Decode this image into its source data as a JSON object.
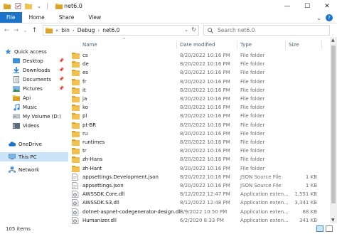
{
  "window": {
    "title": "net6.0",
    "controls": {
      "minimize": "—",
      "maximize": "☐",
      "close": "✕"
    }
  },
  "ribbon": {
    "tabs": [
      "File",
      "Home",
      "Share",
      "View"
    ],
    "expand_glyph": "⌄",
    "help_glyph": "?"
  },
  "address": {
    "back": "←",
    "forward": "→",
    "recent": "⌄",
    "up": "↑",
    "overflow": "«",
    "crumbs": [
      "bin",
      "Debug",
      "net6.0"
    ],
    "separator": "›",
    "dropdown": "⌄",
    "refresh": "↻"
  },
  "search": {
    "placeholder": "Search net6.0",
    "icon": "search-icon"
  },
  "nav": {
    "items": [
      {
        "label": "Quick access",
        "icon": "star-icon",
        "pinned": false
      },
      {
        "label": "Desktop",
        "icon": "desktop-icon",
        "pinned": true
      },
      {
        "label": "Downloads",
        "icon": "download-icon",
        "pinned": true
      },
      {
        "label": "Documents",
        "icon": "documents-icon",
        "pinned": true
      },
      {
        "label": "Pictures",
        "icon": "pictures-icon",
        "pinned": true
      },
      {
        "label": "Api",
        "icon": "folder-icon",
        "pinned": false
      },
      {
        "label": "Music",
        "icon": "music-icon",
        "pinned": false
      },
      {
        "label": "My Volume (D:)",
        "icon": "drive-icon",
        "pinned": false
      },
      {
        "label": "Videos",
        "icon": "videos-icon",
        "pinned": false
      },
      {
        "label": "OneDrive",
        "icon": "cloud-icon",
        "pinned": false
      },
      {
        "label": "This PC",
        "icon": "computer-icon",
        "pinned": false,
        "selected": true
      },
      {
        "label": "Network",
        "icon": "network-icon",
        "pinned": false
      }
    ],
    "pin_glyph": "📌"
  },
  "columns": {
    "name": "Name",
    "date": "Date modified",
    "type": "Type",
    "size": "Size",
    "sort_caret": "^"
  },
  "files": [
    {
      "name": "cs",
      "date": "8/20/2022 10:16 PM",
      "type": "File folder",
      "size": "",
      "kind": "folder"
    },
    {
      "name": "de",
      "date": "8/20/2022 10:16 PM",
      "type": "File folder",
      "size": "",
      "kind": "folder"
    },
    {
      "name": "es",
      "date": "8/20/2022 10:16 PM",
      "type": "File folder",
      "size": "",
      "kind": "folder"
    },
    {
      "name": "fr",
      "date": "8/20/2022 10:16 PM",
      "type": "File folder",
      "size": "",
      "kind": "folder"
    },
    {
      "name": "it",
      "date": "8/20/2022 10:16 PM",
      "type": "File folder",
      "size": "",
      "kind": "folder"
    },
    {
      "name": "ja",
      "date": "8/20/2022 10:16 PM",
      "type": "File folder",
      "size": "",
      "kind": "folder"
    },
    {
      "name": "ko",
      "date": "8/20/2022 10:16 PM",
      "type": "File folder",
      "size": "",
      "kind": "folder"
    },
    {
      "name": "pl",
      "date": "8/20/2022 10:16 PM",
      "type": "File folder",
      "size": "",
      "kind": "folder"
    },
    {
      "name": "pt-BR",
      "date": "8/20/2022 10:16 PM",
      "type": "File folder",
      "size": "",
      "kind": "folder"
    },
    {
      "name": "ru",
      "date": "8/20/2022 10:16 PM",
      "type": "File folder",
      "size": "",
      "kind": "folder"
    },
    {
      "name": "runtimes",
      "date": "8/20/2022 10:16 PM",
      "type": "File folder",
      "size": "",
      "kind": "folder"
    },
    {
      "name": "tr",
      "date": "8/20/2022 10:16 PM",
      "type": "File folder",
      "size": "",
      "kind": "folder"
    },
    {
      "name": "zh-Hans",
      "date": "8/20/2022 10:16 PM",
      "type": "File folder",
      "size": "",
      "kind": "folder"
    },
    {
      "name": "zh-Hant",
      "date": "8/20/2022 10:16 PM",
      "type": "File folder",
      "size": "",
      "kind": "folder"
    },
    {
      "name": "appsettings.Development.json",
      "date": "8/20/2022 10:16 PM",
      "type": "JSON Source File",
      "size": "1 KB",
      "kind": "json"
    },
    {
      "name": "appsettings.json",
      "date": "8/20/2022 10:16 PM",
      "type": "JSON Source File",
      "size": "1 KB",
      "kind": "json"
    },
    {
      "name": "AWSSDK.Core.dll",
      "date": "8/12/2022 12:47 PM",
      "type": "Application exten...",
      "size": "1,551 KB",
      "kind": "dll"
    },
    {
      "name": "AWSSDK.S3.dll",
      "date": "8/12/2022 12:48 PM",
      "type": "Application exten...",
      "size": "3,341 KB",
      "kind": "dll"
    },
    {
      "name": "dotnet-aspnet-codegenerator-design.dll",
      "date": "8/9/2022 10:50 PM",
      "type": "Application exten...",
      "size": "68 KB",
      "kind": "dll"
    },
    {
      "name": "Humanizer.dll",
      "date": "6/2/2020 8:33 PM",
      "type": "Application exten...",
      "size": "341 KB",
      "kind": "dll"
    }
  ],
  "status": {
    "count": "105 items"
  },
  "colors": {
    "accent": "#1a73c8",
    "selection": "#cce4f7",
    "folder": "#f2c14e",
    "folder_dark": "#dca32a"
  }
}
